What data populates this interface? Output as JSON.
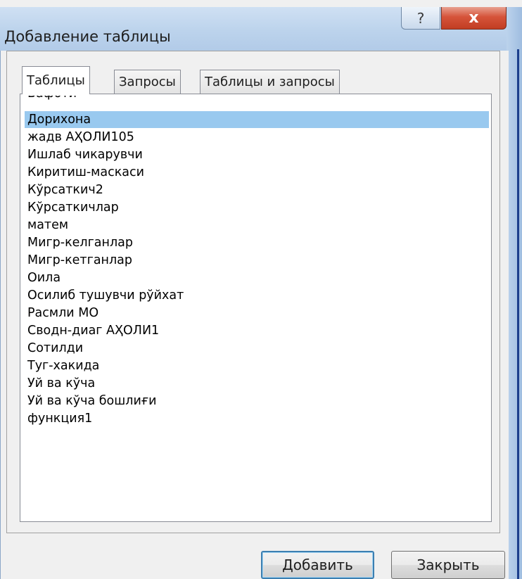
{
  "window": {
    "title": "Добавление таблицы",
    "help_glyph": "?",
    "close_glyph": "x"
  },
  "tabs": [
    {
      "label": "Таблицы",
      "active": true
    },
    {
      "label": "Запросы",
      "active": false
    },
    {
      "label": "Таблицы и запросы",
      "active": false
    }
  ],
  "list": {
    "items": [
      "Вафоти",
      "Дорихона",
      "жадв АҲОЛИ105",
      "Ишлаб чикарувчи",
      "Киритиш-маскаси",
      "Кўрсаткич2",
      "Кўрсаткичлар",
      "матем",
      "Мигр-келганлар",
      "Мигр-кетганлар",
      "Оила",
      "Осилиб тушувчи рўйхат",
      "Расмли МО",
      "Сводн-диаг АҲОЛИ1",
      "Сотилди",
      "Туг-хакида",
      "Уй ва кўча",
      "Уй ва кўча бошлиғи",
      "функция1"
    ],
    "selected_index": 1
  },
  "buttons": {
    "add_label": "Добавить",
    "close_label": "Закрыть"
  },
  "colors": {
    "selection": "#99c9ef",
    "close_button": "#c9432a"
  }
}
